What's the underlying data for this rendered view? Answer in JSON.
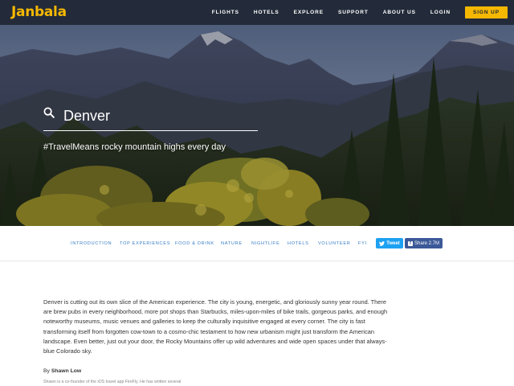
{
  "header": {
    "logo": "Janbala",
    "nav": [
      "FLIGHTS",
      "HOTELS",
      "EXPLORE",
      "SUPPORT",
      "ABOUT US",
      "LOGIN"
    ],
    "signup_label": "SIGN UP",
    "colors": {
      "bar": "#232b3a",
      "accent": "#f5b800"
    }
  },
  "hero": {
    "search_value": "Denver",
    "tagline": "#TravelMeans rocky mountain highs every day"
  },
  "section_nav": {
    "items": [
      "INTRODUCTION",
      "TOP EXPERIENCES",
      "FOOD & DRINK",
      "NATURE",
      "NIGHTLIFE",
      "HOTELS",
      "VOLUNTEER",
      "FYI"
    ],
    "tweet_label": "Tweet",
    "share_label": "Share 2.7M"
  },
  "article": {
    "body": "Denver is cutting out its own slice of the American experience. The city is young, energetic, and gloriously sunny year round. There are brew pubs in every neighborhood, more pot shops than Starbucks, miles-upon-miles of bike trails, gorgeous parks, and enough noteworthy museums, music venues and galleries to keep the culturally inquisitive engaged at every corner. The city is fast transforming itself from forgotten cow-town to a cosmo-chic testament to how new urbanism might just transform the American landscape. Even better, just out your door, the Rocky Mountains offer up wild adventures and wide open spaces under that always-blue Colorado sky.",
    "by_prefix": "By",
    "author": "Shawn Low",
    "bio": "Shawn is a co-founder of the iOS travel app FireFly. He has written several"
  }
}
